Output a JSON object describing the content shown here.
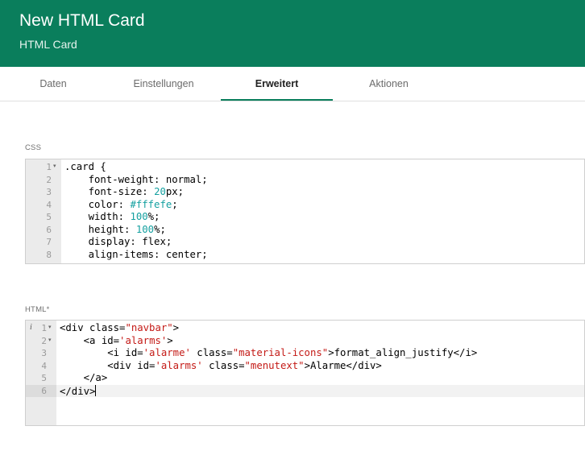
{
  "header": {
    "title": "New HTML Card",
    "subtitle": "HTML Card"
  },
  "tabs": [
    {
      "label": "Daten",
      "active": false
    },
    {
      "label": "Einstellungen",
      "active": false
    },
    {
      "label": "Erweitert",
      "active": true
    },
    {
      "label": "Aktionen",
      "active": false
    }
  ],
  "css_editor": {
    "label": "CSS",
    "line_numbers": [
      "1",
      "2",
      "3",
      "4",
      "5",
      "6",
      "7",
      "8"
    ],
    "lines": [
      [
        {
          "t": ".card {",
          "c": "plain"
        }
      ],
      [
        {
          "t": "    font-weight: normal;",
          "c": "plain"
        }
      ],
      [
        {
          "t": "    font-size: ",
          "c": "plain"
        },
        {
          "t": "20",
          "c": "num"
        },
        {
          "t": "px;",
          "c": "plain"
        }
      ],
      [
        {
          "t": "    color: ",
          "c": "plain"
        },
        {
          "t": "#fffefe",
          "c": "num"
        },
        {
          "t": ";",
          "c": "plain"
        }
      ],
      [
        {
          "t": "    width: ",
          "c": "plain"
        },
        {
          "t": "100",
          "c": "num"
        },
        {
          "t": "%;",
          "c": "plain"
        }
      ],
      [
        {
          "t": "    height: ",
          "c": "plain"
        },
        {
          "t": "100",
          "c": "num"
        },
        {
          "t": "%;",
          "c": "plain"
        }
      ],
      [
        {
          "t": "    display: flex;",
          "c": "plain"
        }
      ],
      [
        {
          "t": "    align-items: center;",
          "c": "plain"
        }
      ]
    ]
  },
  "html_editor": {
    "label": "HTML*",
    "line_numbers": [
      "1",
      "2",
      "3",
      "4",
      "5",
      "6"
    ],
    "lines": [
      [
        {
          "t": "<div class=",
          "c": "plain"
        },
        {
          "t": "\"navbar\"",
          "c": "str"
        },
        {
          "t": ">",
          "c": "plain"
        }
      ],
      [
        {
          "t": "    <a id=",
          "c": "plain"
        },
        {
          "t": "'alarms'",
          "c": "str"
        },
        {
          "t": ">",
          "c": "plain"
        }
      ],
      [
        {
          "t": "        <i id=",
          "c": "plain"
        },
        {
          "t": "'alarme'",
          "c": "str"
        },
        {
          "t": " class=",
          "c": "plain"
        },
        {
          "t": "\"material-icons\"",
          "c": "str"
        },
        {
          "t": ">format_align_justify</i>",
          "c": "plain"
        }
      ],
      [
        {
          "t": "        <div id=",
          "c": "plain"
        },
        {
          "t": "'alarms'",
          "c": "str"
        },
        {
          "t": " class=",
          "c": "plain"
        },
        {
          "t": "\"menutext\"",
          "c": "str"
        },
        {
          "t": ">Alarme</div>",
          "c": "plain"
        }
      ],
      [
        {
          "t": "    </a>",
          "c": "plain"
        }
      ],
      [
        {
          "t": "</div>",
          "c": "plain"
        }
      ]
    ]
  }
}
